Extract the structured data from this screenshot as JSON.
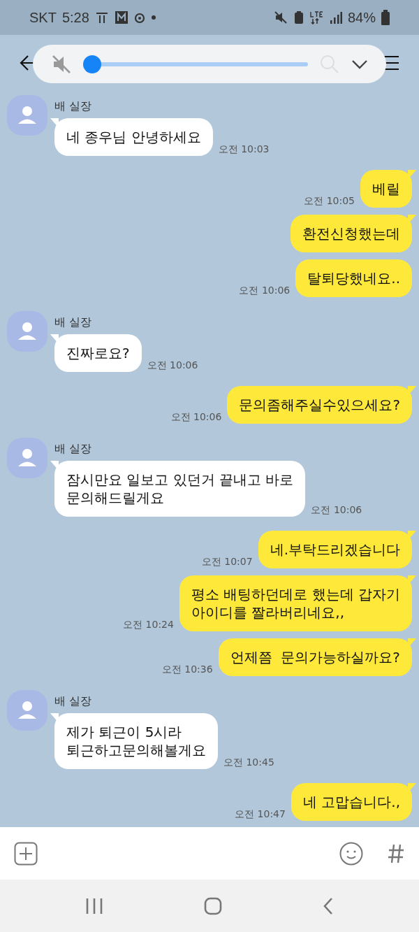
{
  "status_bar": {
    "carrier": "SKT",
    "time": "5:28",
    "battery": "84%"
  },
  "volume": {
    "muted": true,
    "level": 0
  },
  "messages": [
    {
      "kind": "in",
      "name": "배 실장",
      "bubbles": [
        "네 종우님 안녕하세요"
      ],
      "time": "오전 10:03"
    },
    {
      "kind": "out",
      "bubbles": [
        "베릴"
      ],
      "time": "오전 10:05"
    },
    {
      "kind": "out",
      "bubbles": [
        "환전신청했는데",
        "탈퇴당했네요.."
      ],
      "time": "오전 10:06"
    },
    {
      "kind": "in",
      "name": "배 실장",
      "bubbles": [
        "진짜로요?"
      ],
      "time": "오전 10:06"
    },
    {
      "kind": "out",
      "bubbles": [
        "문의좀해주실수있으세요?"
      ],
      "time": "오전 10:06"
    },
    {
      "kind": "in",
      "name": "배 실장",
      "bubbles": [
        "잠시만요 일보고 있던거 끝내고 바로\n문의해드릴게요"
      ],
      "time": "오전 10:06"
    },
    {
      "kind": "out",
      "bubbles": [
        "네.부탁드리겠습니다"
      ],
      "time": "오전 10:07"
    },
    {
      "kind": "out",
      "bubbles": [
        "평소 배팅하던데로 했는데 갑자기\n아이디를 짤라버리네요,,"
      ],
      "time": "오전 10:24"
    },
    {
      "kind": "out",
      "bubbles": [
        "언제쯤  문의가능하실까요?"
      ],
      "time": "오전 10:36"
    },
    {
      "kind": "in",
      "name": "배 실장",
      "bubbles": [
        "제가 퇴근이 5시라\n퇴근하고문의해볼게요"
      ],
      "time": "오전 10:45"
    },
    {
      "kind": "out",
      "bubbles": [
        "네 고맙습니다.,"
      ],
      "time": "오전 10:47"
    }
  ]
}
